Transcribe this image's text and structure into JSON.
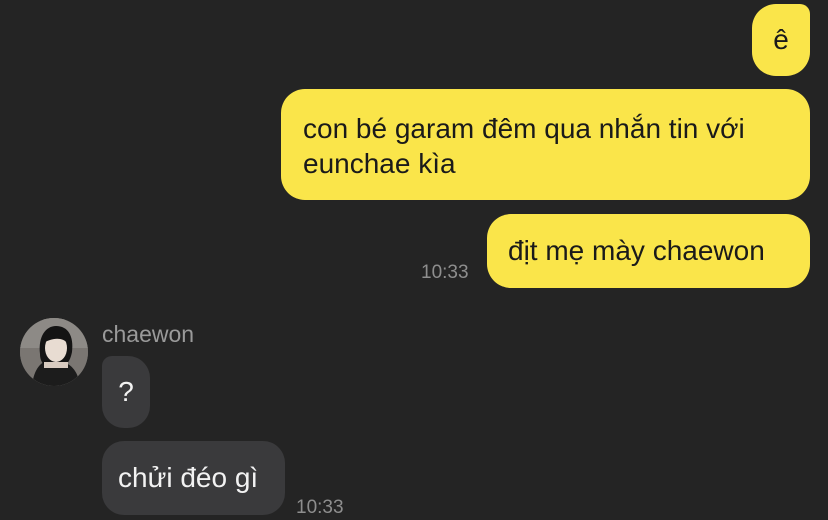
{
  "messages_out": [
    {
      "text": "ê"
    },
    {
      "text": "con bé garam đêm qua nhắn tin với eunchae kìa"
    },
    {
      "text": "địt mẹ mày chaewon"
    }
  ],
  "out_time": "10:33",
  "contact": {
    "name": "chaewon",
    "avatar": "profile-photo"
  },
  "messages_in": [
    {
      "text": "?"
    },
    {
      "text": "chửi đéo gì"
    }
  ],
  "in_time": "10:33",
  "colors": {
    "background": "#242424",
    "outgoing_bubble": "#fae54a",
    "incoming_bubble": "#3a3a3c"
  }
}
